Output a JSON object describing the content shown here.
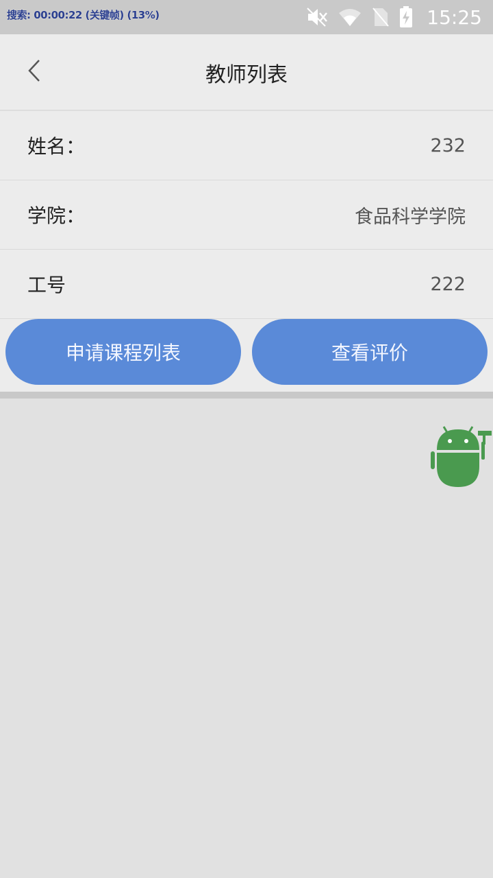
{
  "status_bar": {
    "overlay_text": "搜索: 00:00:22 (关键帧) (13%)",
    "time": "15:25",
    "icons": [
      "mute-icon",
      "wifi-icon",
      "no-sim-icon",
      "battery-charging-icon"
    ]
  },
  "header": {
    "title": "教师列表",
    "back_icon": "chevron-left-icon"
  },
  "info_rows": [
    {
      "label": "姓名：",
      "value": "232"
    },
    {
      "label": "学院：",
      "value": "食品科学学院"
    },
    {
      "label": "工号",
      "value": "222"
    }
  ],
  "actions": {
    "apply_courses_label": "申请课程列表",
    "view_reviews_label": "查看评价"
  },
  "floating": {
    "icon": "android-robot-icon"
  },
  "colors": {
    "button": "#5a8ad8",
    "robot": "#4a9a4f"
  }
}
